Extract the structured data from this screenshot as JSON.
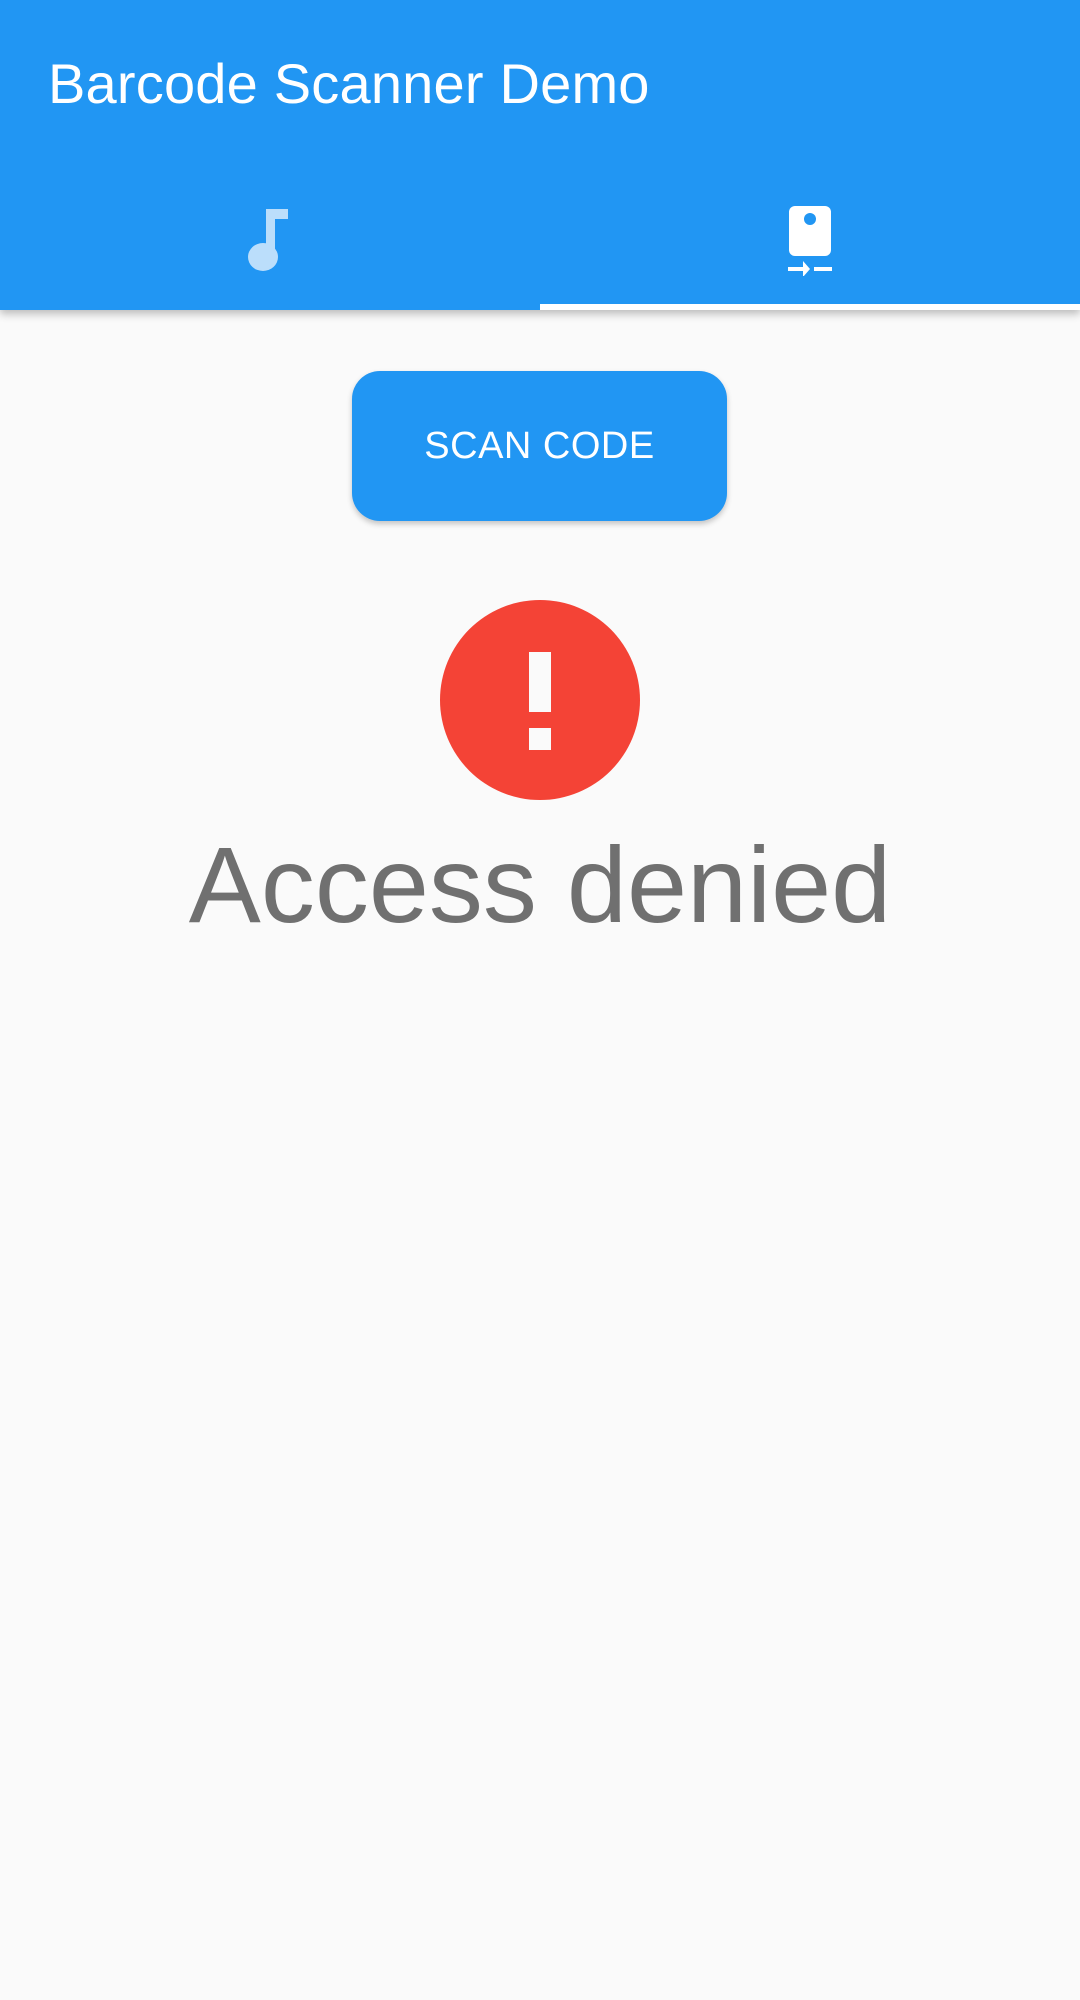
{
  "app_bar": {
    "title": "Barcode Scanner Demo",
    "background_color": "#2196f3"
  },
  "tabs": [
    {
      "icon": "music-note-icon",
      "selected": false
    },
    {
      "icon": "phone-camera-rear-icon",
      "selected": true
    }
  ],
  "main": {
    "scan_button_label": "SCAN CODE",
    "status_icon": "error-icon",
    "status_icon_color": "#f44336",
    "status_text": "Access denied",
    "status_text_color": "#707070"
  }
}
